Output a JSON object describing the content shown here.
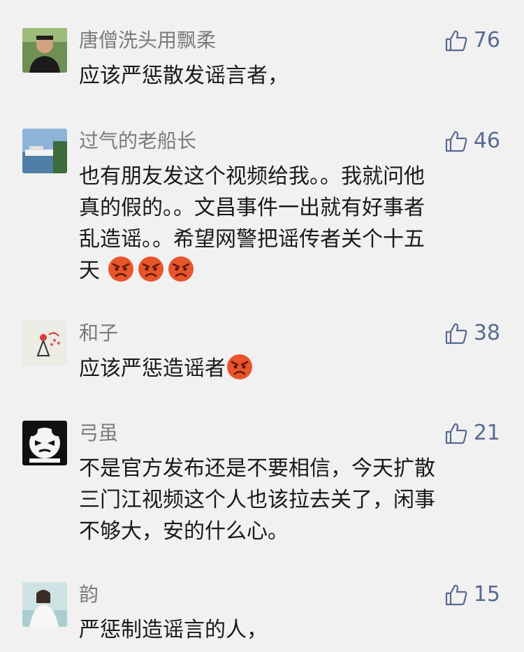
{
  "comments": [
    {
      "name": "唐僧洗头用飘柔",
      "likes": "76",
      "text": "应该严惩散发谣言者，",
      "emoji": []
    },
    {
      "name": "过气的老船长",
      "likes": "46",
      "text": "也有朋友发这个视频给我。。我就问他\n真的假的。。文昌事件一出就有好事者\n乱造谣。。希望网警把谣传者关个十五\n天",
      "emoji": [
        "angry-face-icon",
        "angry-face-icon",
        "angry-face-icon"
      ]
    },
    {
      "name": "和子",
      "likes": "38",
      "text": "应该严惩造谣者",
      "emoji": [
        "angry-face-icon"
      ]
    },
    {
      "name": "弓虽",
      "likes": "21",
      "text": "不是官方发布还是不要相信，今天扩散\n三门江视频这个人也该拉去关了，闲事\n不够大，安的什么心。",
      "emoji": []
    },
    {
      "name": "韵",
      "likes": "15",
      "text": "严惩制造谣言的人，",
      "emoji": []
    }
  ],
  "icons": {
    "like": "thumbs-up-icon",
    "reaction": "angry-face-icon"
  },
  "colors": {
    "background": "#f1f1f1",
    "name": "#7b7b7b",
    "like": "#586a92",
    "text": "#191919",
    "emoji": "#e8552b"
  }
}
